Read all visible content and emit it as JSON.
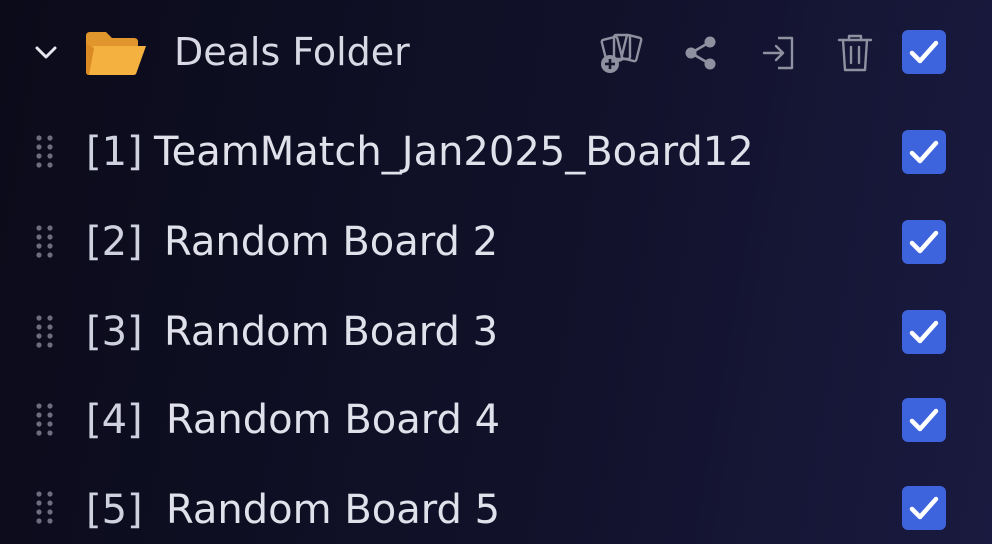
{
  "folder": {
    "name": "Deals Folder",
    "expanded": true,
    "checked": true,
    "icon": "folder-icon",
    "accent_color": "#f2a93b",
    "toolbar": [
      {
        "name": "add-deal-icon"
      },
      {
        "name": "share-icon"
      },
      {
        "name": "export-icon"
      },
      {
        "name": "trash-icon"
      }
    ]
  },
  "checkbox_color": "#3d63dd",
  "boards": [
    {
      "index": "[1]",
      "label": "TeamMatch_Jan2025_Board12",
      "checked": true
    },
    {
      "index": "[2]",
      "label": "Random Board 2",
      "checked": true
    },
    {
      "index": "[3]",
      "label": "Random Board 3",
      "checked": true
    },
    {
      "index": "[4]",
      "label": "Random Board 4",
      "checked": true
    },
    {
      "index": "[5]",
      "label": "Random Board 5",
      "checked": true
    }
  ]
}
